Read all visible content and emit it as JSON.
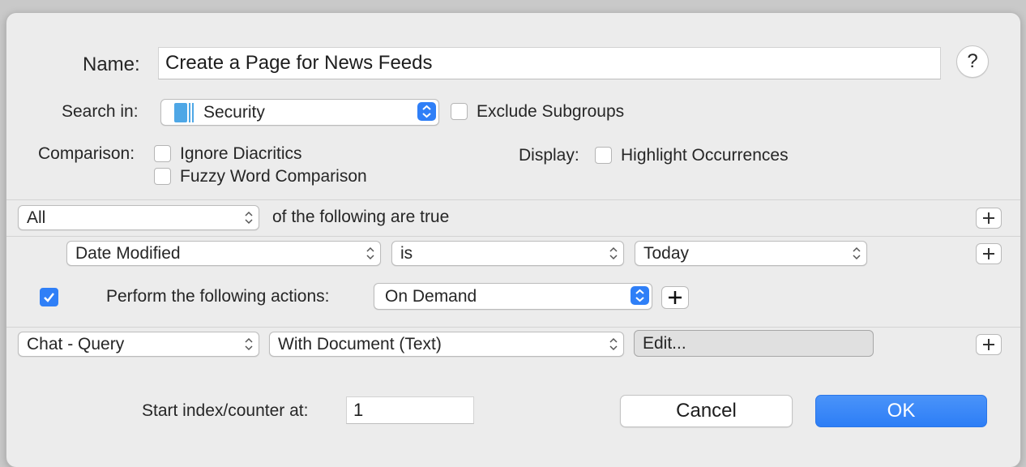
{
  "name_row": {
    "label": "Name:",
    "value": "Create a Page for News Feeds"
  },
  "help_button": "?",
  "search_in": {
    "label": "Search in:",
    "selected": "Security",
    "exclude_subgroups": "Exclude Subgroups",
    "exclude_checked": false
  },
  "comparison": {
    "label": "Comparison:",
    "ignore_diacritics": "Ignore Diacritics",
    "fuzzy_word": "Fuzzy Word Comparison"
  },
  "display": {
    "label": "Display:",
    "highlight": "Highlight Occurrences"
  },
  "condition_group": {
    "match": "All",
    "suffix": "of the following are true"
  },
  "criterion": {
    "field": "Date Modified",
    "operator": "is",
    "value": "Today"
  },
  "actions": {
    "enabled": true,
    "label": "Perform the following actions:",
    "trigger": "On Demand"
  },
  "action_row": {
    "action": "Chat - Query",
    "option": "With Document (Text)",
    "edit_label": "Edit..."
  },
  "counter": {
    "label": "Start index/counter at:",
    "value": "1"
  },
  "buttons": {
    "cancel": "Cancel",
    "ok": "OK"
  },
  "colors": {
    "accent": "#2f7ff7",
    "background": "#ececec"
  }
}
